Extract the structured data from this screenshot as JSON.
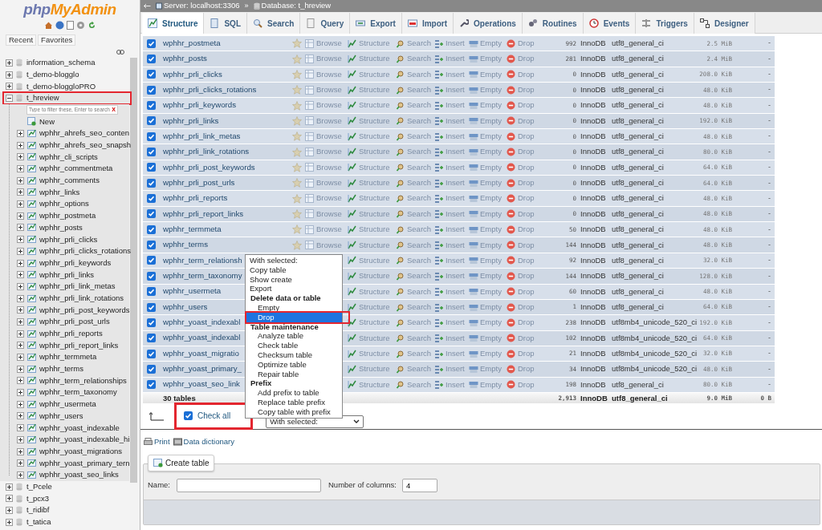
{
  "sidebar": {
    "logo": [
      "php",
      "MyAdmin"
    ],
    "buttons": [
      "Recent",
      "Favorites"
    ],
    "tree": [
      {
        "label": "information_schema",
        "expanded": false,
        "highlighted": false
      },
      {
        "label": "t_demo-blogglo",
        "expanded": false,
        "highlighted": false
      },
      {
        "label": "t_demo-bloggloPRO",
        "expanded": false,
        "highlighted": false
      },
      {
        "label": "t_hreview",
        "expanded": true,
        "highlighted": true,
        "filter": {
          "placeholder": "Type to filter these, Enter to search",
          "clear": "X"
        },
        "new_item": "New",
        "children": [
          {
            "label": "wphhr_ahrefs_seo_conten",
            "expanded": false
          },
          {
            "label": "wphhr_ahrefs_seo_snapsh",
            "expanded": false
          },
          {
            "label": "wphhr_cli_scripts",
            "expanded": false
          },
          {
            "label": "wphhr_commentmeta",
            "expanded": false
          },
          {
            "label": "wphhr_comments",
            "expanded": false
          },
          {
            "label": "wphhr_links",
            "expanded": false
          },
          {
            "label": "wphhr_options",
            "expanded": false
          },
          {
            "label": "wphhr_postmeta",
            "expanded": false
          },
          {
            "label": "wphhr_posts",
            "expanded": false
          },
          {
            "label": "wphhr_prli_clicks",
            "expanded": false
          },
          {
            "label": "wphhr_prli_clicks_rotations",
            "expanded": false
          },
          {
            "label": "wphhr_prli_keywords",
            "expanded": false
          },
          {
            "label": "wphhr_prli_links",
            "expanded": false
          },
          {
            "label": "wphhr_prli_link_metas",
            "expanded": false
          },
          {
            "label": "wphhr_prli_link_rotations",
            "expanded": false
          },
          {
            "label": "wphhr_prli_post_keywords",
            "expanded": false
          },
          {
            "label": "wphhr_prli_post_urls",
            "expanded": false
          },
          {
            "label": "wphhr_prli_reports",
            "expanded": false
          },
          {
            "label": "wphhr_prli_report_links",
            "expanded": false
          },
          {
            "label": "wphhr_termmeta",
            "expanded": false
          },
          {
            "label": "wphhr_terms",
            "expanded": false
          },
          {
            "label": "wphhr_term_relationships",
            "expanded": false
          },
          {
            "label": "wphhr_term_taxonomy",
            "expanded": false
          },
          {
            "label": "wphhr_usermeta",
            "expanded": false
          },
          {
            "label": "wphhr_users",
            "expanded": false
          },
          {
            "label": "wphhr_yoast_indexable",
            "expanded": false
          },
          {
            "label": "wphhr_yoast_indexable_hi",
            "expanded": false
          },
          {
            "label": "wphhr_yoast_migrations",
            "expanded": false
          },
          {
            "label": "wphhr_yoast_primary_tern",
            "expanded": false
          },
          {
            "label": "wphhr_yoast_seo_links",
            "expanded": false
          }
        ]
      },
      {
        "label": "t_Pcele",
        "expanded": false,
        "highlighted": false
      },
      {
        "label": "t_pcx3",
        "expanded": false,
        "highlighted": false
      },
      {
        "label": "t_ridibf",
        "expanded": false,
        "highlighted": false
      },
      {
        "label": "t_tatica",
        "expanded": false,
        "highlighted": false
      }
    ]
  },
  "breadcrumb": {
    "items": [
      "Server: localhost:3306",
      "Database: t_hreview"
    ],
    "separator": "»"
  },
  "tabs": [
    {
      "label": "Structure",
      "selected": true
    },
    {
      "label": "SQL",
      "selected": false
    },
    {
      "label": "Search",
      "selected": false
    },
    {
      "label": "Query",
      "selected": false
    },
    {
      "label": "Export",
      "selected": false
    },
    {
      "label": "Import",
      "selected": false
    },
    {
      "label": "Operations",
      "selected": false
    },
    {
      "label": "Routines",
      "selected": false
    },
    {
      "label": "Events",
      "selected": false
    },
    {
      "label": "Triggers",
      "selected": false
    },
    {
      "label": "Designer",
      "selected": false
    }
  ],
  "table": {
    "rows": [
      {
        "checked": true,
        "name": "wphhr_postmeta",
        "actions": [
          "Browse",
          "Structure",
          "Search",
          "Insert",
          "Empty",
          "Drop"
        ],
        "rows": "992",
        "engine": "InnoDB",
        "collation": "utf8_general_ci",
        "size": "2.5 MiB",
        "overhead": "-"
      },
      {
        "checked": true,
        "name": "wphhr_posts",
        "actions": [
          "Browse",
          "Structure",
          "Search",
          "Insert",
          "Empty",
          "Drop"
        ],
        "rows": "281",
        "engine": "InnoDB",
        "collation": "utf8_general_ci",
        "size": "2.4 MiB",
        "overhead": "-"
      },
      {
        "checked": true,
        "name": "wphhr_prli_clicks",
        "actions": [
          "Browse",
          "Structure",
          "Search",
          "Insert",
          "Empty",
          "Drop"
        ],
        "rows": "0",
        "engine": "InnoDB",
        "collation": "utf8_general_ci",
        "size": "208.0 KiB",
        "overhead": "-"
      },
      {
        "checked": true,
        "name": "wphhr_prli_clicks_rotations",
        "actions": [
          "Browse",
          "Structure",
          "Search",
          "Insert",
          "Empty",
          "Drop"
        ],
        "rows": "0",
        "engine": "InnoDB",
        "collation": "utf8_general_ci",
        "size": "48.0 KiB",
        "overhead": "-"
      },
      {
        "checked": true,
        "name": "wphhr_prli_keywords",
        "actions": [
          "Browse",
          "Structure",
          "Search",
          "Insert",
          "Empty",
          "Drop"
        ],
        "rows": "0",
        "engine": "InnoDB",
        "collation": "utf8_general_ci",
        "size": "48.0 KiB",
        "overhead": "-"
      },
      {
        "checked": true,
        "name": "wphhr_prli_links",
        "actions": [
          "Browse",
          "Structure",
          "Search",
          "Insert",
          "Empty",
          "Drop"
        ],
        "rows": "0",
        "engine": "InnoDB",
        "collation": "utf8_general_ci",
        "size": "192.0 KiB",
        "overhead": "-"
      },
      {
        "checked": true,
        "name": "wphhr_prli_link_metas",
        "actions": [
          "Browse",
          "Structure",
          "Search",
          "Insert",
          "Empty",
          "Drop"
        ],
        "rows": "0",
        "engine": "InnoDB",
        "collation": "utf8_general_ci",
        "size": "48.0 KiB",
        "overhead": "-"
      },
      {
        "checked": true,
        "name": "wphhr_prli_link_rotations",
        "actions": [
          "Browse",
          "Structure",
          "Search",
          "Insert",
          "Empty",
          "Drop"
        ],
        "rows": "0",
        "engine": "InnoDB",
        "collation": "utf8_general_ci",
        "size": "80.0 KiB",
        "overhead": "-"
      },
      {
        "checked": true,
        "name": "wphhr_prli_post_keywords",
        "actions": [
          "Browse",
          "Structure",
          "Search",
          "Insert",
          "Empty",
          "Drop"
        ],
        "rows": "0",
        "engine": "InnoDB",
        "collation": "utf8_general_ci",
        "size": "64.0 KiB",
        "overhead": "-"
      },
      {
        "checked": true,
        "name": "wphhr_prli_post_urls",
        "actions": [
          "Browse",
          "Structure",
          "Search",
          "Insert",
          "Empty",
          "Drop"
        ],
        "rows": "0",
        "engine": "InnoDB",
        "collation": "utf8_general_ci",
        "size": "64.0 KiB",
        "overhead": "-"
      },
      {
        "checked": true,
        "name": "wphhr_prli_reports",
        "actions": [
          "Browse",
          "Structure",
          "Search",
          "Insert",
          "Empty",
          "Drop"
        ],
        "rows": "0",
        "engine": "InnoDB",
        "collation": "utf8_general_ci",
        "size": "48.0 KiB",
        "overhead": "-"
      },
      {
        "checked": true,
        "name": "wphhr_prli_report_links",
        "actions": [
          "Browse",
          "Structure",
          "Search",
          "Insert",
          "Empty",
          "Drop"
        ],
        "rows": "0",
        "engine": "InnoDB",
        "collation": "utf8_general_ci",
        "size": "48.0 KiB",
        "overhead": "-"
      },
      {
        "checked": true,
        "name": "wphhr_termmeta",
        "actions": [
          "Browse",
          "Structure",
          "Search",
          "Insert",
          "Empty",
          "Drop"
        ],
        "rows": "50",
        "engine": "InnoDB",
        "collation": "utf8_general_ci",
        "size": "48.0 KiB",
        "overhead": "-"
      },
      {
        "checked": true,
        "name": "wphhr_terms",
        "actions": [
          "Browse",
          "Structure",
          "Search",
          "Insert",
          "Empty",
          "Drop"
        ],
        "rows": "144",
        "engine": "InnoDB",
        "collation": "utf8_general_ci",
        "size": "48.0 KiB",
        "overhead": "-"
      },
      {
        "checked": true,
        "name": "wphhr_term_relationsh",
        "actions": [
          "Structure",
          "Search",
          "Insert",
          "Empty",
          "Drop"
        ],
        "rows": "92",
        "engine": "InnoDB",
        "collation": "utf8_general_ci",
        "size": "32.0 KiB",
        "overhead": "-"
      },
      {
        "checked": true,
        "name": "wphhr_term_taxonomy",
        "actions": [
          "Structure",
          "Search",
          "Insert",
          "Empty",
          "Drop"
        ],
        "rows": "144",
        "engine": "InnoDB",
        "collation": "utf8_general_ci",
        "size": "128.0 KiB",
        "overhead": "-"
      },
      {
        "checked": true,
        "name": "wphhr_usermeta",
        "actions": [
          "Structure",
          "Search",
          "Insert",
          "Empty",
          "Drop"
        ],
        "rows": "60",
        "engine": "InnoDB",
        "collation": "utf8_general_ci",
        "size": "48.0 KiB",
        "overhead": "-"
      },
      {
        "checked": true,
        "name": "wphhr_users",
        "actions": [
          "Structure",
          "Search",
          "Insert",
          "Empty",
          "Drop"
        ],
        "rows": "1",
        "engine": "InnoDB",
        "collation": "utf8_general_ci",
        "size": "64.0 KiB",
        "overhead": "-"
      },
      {
        "checked": true,
        "name": "wphhr_yoast_indexabl",
        "actions": [
          "Structure",
          "Search",
          "Insert",
          "Empty",
          "Drop"
        ],
        "rows": "238",
        "engine": "InnoDB",
        "collation": "utf8mb4_unicode_520_ci",
        "size": "192.0 KiB",
        "overhead": "-"
      },
      {
        "checked": true,
        "name": "wphhr_yoast_indexabl",
        "actions": [
          "Structure",
          "Search",
          "Insert",
          "Empty",
          "Drop"
        ],
        "rows": "102",
        "engine": "InnoDB",
        "collation": "utf8mb4_unicode_520_ci",
        "size": "64.0 KiB",
        "overhead": "-"
      },
      {
        "checked": true,
        "name": "wphhr_yoast_migratio",
        "actions": [
          "Structure",
          "Search",
          "Insert",
          "Empty",
          "Drop"
        ],
        "rows": "21",
        "engine": "InnoDB",
        "collation": "utf8mb4_unicode_520_ci",
        "size": "32.0 KiB",
        "overhead": "-"
      },
      {
        "checked": true,
        "name": "wphhr_yoast_primary_",
        "actions": [
          "Structure",
          "Search",
          "Insert",
          "Empty",
          "Drop"
        ],
        "rows": "34",
        "engine": "InnoDB",
        "collation": "utf8mb4_unicode_520_ci",
        "size": "48.0 KiB",
        "overhead": "-"
      },
      {
        "checked": true,
        "name": "wphhr_yoast_seo_link",
        "actions": [
          "Structure",
          "Search",
          "Insert",
          "Empty",
          "Drop"
        ],
        "rows": "198",
        "engine": "InnoDB",
        "collation": "utf8_general_ci",
        "size": "80.0 KiB",
        "overhead": "-"
      }
    ],
    "footer": {
      "count": "30 tables",
      "rows": "2,913",
      "engine": "InnoDB",
      "collation": "utf8_general_ci",
      "size": "9.0 MiB",
      "overhead": "0 B"
    }
  },
  "bulk": {
    "check_all": {
      "label": "Check all",
      "checked": true,
      "highlighted": true
    },
    "select": "With selected:",
    "menu": [
      {
        "label": "With selected:",
        "kind": "option",
        "selected": false,
        "highlighted": false
      },
      {
        "label": "Copy table",
        "kind": "option",
        "selected": false,
        "highlighted": false
      },
      {
        "label": "Show create",
        "kind": "option",
        "selected": false,
        "highlighted": false
      },
      {
        "label": "Export",
        "kind": "option",
        "selected": false,
        "highlighted": false
      },
      {
        "label": "Delete data or table",
        "kind": "group",
        "selected": false,
        "highlighted": false
      },
      {
        "label": "Empty",
        "kind": "sub",
        "selected": false,
        "highlighted": false
      },
      {
        "label": "Drop",
        "kind": "sub",
        "selected": true,
        "highlighted": true
      },
      {
        "label": "Table maintenance",
        "kind": "group",
        "selected": false,
        "highlighted": false
      },
      {
        "label": "Analyze table",
        "kind": "sub",
        "selected": false,
        "highlighted": false
      },
      {
        "label": "Check table",
        "kind": "sub",
        "selected": false,
        "highlighted": false
      },
      {
        "label": "Checksum table",
        "kind": "sub",
        "selected": false,
        "highlighted": false
      },
      {
        "label": "Optimize table",
        "kind": "sub",
        "selected": false,
        "highlighted": false
      },
      {
        "label": "Repair table",
        "kind": "sub",
        "selected": false,
        "highlighted": false
      },
      {
        "label": "Prefix",
        "kind": "group",
        "selected": false,
        "highlighted": false
      },
      {
        "label": "Add prefix to table",
        "kind": "sub",
        "selected": false,
        "highlighted": false
      },
      {
        "label": "Replace table prefix",
        "kind": "sub",
        "selected": false,
        "highlighted": false
      },
      {
        "label": "Copy table with prefix",
        "kind": "sub",
        "selected": false,
        "highlighted": false
      }
    ]
  },
  "links": [
    "Print",
    "Data dictionary"
  ],
  "create_table": {
    "button": "Create table",
    "name_label": "Name:",
    "columns_label": "Number of columns:",
    "columns_value": "4"
  }
}
